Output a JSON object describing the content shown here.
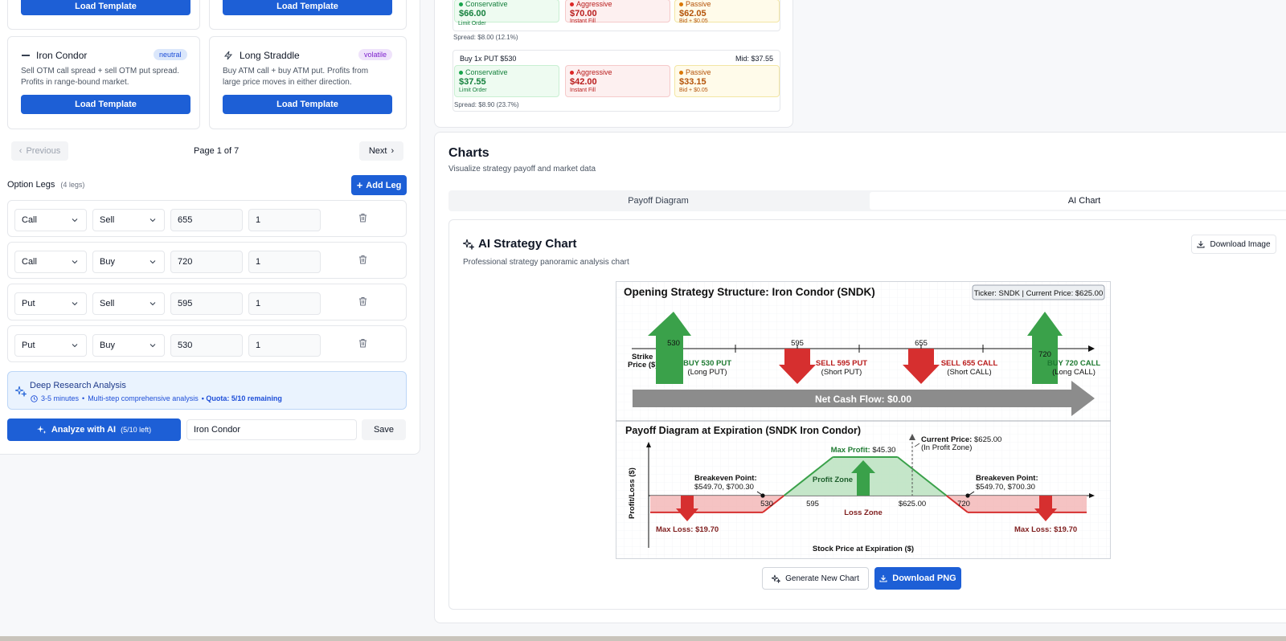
{
  "templates": {
    "top_buttons": [
      "Load Template",
      "Load Template"
    ],
    "cards": [
      {
        "name": "Iron Condor",
        "tag": "neutral",
        "description_1": "Sell OTM call spread + sell OTM put spread.",
        "description_2": "Profits in range-bound market.",
        "button": "Load Template"
      },
      {
        "name": "Long Straddle",
        "tag": "volatile",
        "description_1": "Buy ATM call + buy ATM put. Profits from",
        "description_2": "large price moves in either direction.",
        "button": "Load Template"
      }
    ],
    "pagination": {
      "previous": "Previous",
      "page": "Page 1 of 7",
      "next": "Next"
    }
  },
  "legs_section": {
    "title": "Option Legs",
    "count": "(4 legs)",
    "add_button": "Add Leg"
  },
  "legs": [
    {
      "type": "Call",
      "action": "Sell",
      "strike": "655",
      "qty": "1"
    },
    {
      "type": "Call",
      "action": "Buy",
      "strike": "720",
      "qty": "1"
    },
    {
      "type": "Put",
      "action": "Sell",
      "strike": "595",
      "qty": "1"
    },
    {
      "type": "Put",
      "action": "Buy",
      "strike": "530",
      "qty": "1"
    }
  ],
  "research": {
    "title": "Deep Research Analysis",
    "duration": "3-5 minutes",
    "detail": "Multi-step comprehensive analysis",
    "quota": "• Quota: 5/10 remaining"
  },
  "analyze": {
    "button": "Analyze with AI",
    "left": "(5/10 left)",
    "name_value": "Iron Condor",
    "save": "Save"
  },
  "quotes": {
    "top": {
      "cons_label": "Conservative",
      "cons_price": "$66.00",
      "cons_sub": "Limit Order",
      "aggr_label": "Aggressive",
      "aggr_price": "$70.00",
      "aggr_sub": "Instant Fill",
      "pass_label": "Passive",
      "pass_price": "$62.05",
      "pass_sub": "Bid + $0.05",
      "spread": "Spread: $8.00 (12.1%)"
    },
    "put": {
      "title": "Buy 1x PUT $530",
      "mid": "Mid: $37.55",
      "cons_label": "Conservative",
      "cons_price": "$37.55",
      "cons_sub": "Limit Order",
      "aggr_label": "Aggressive",
      "aggr_price": "$42.00",
      "aggr_sub": "Instant Fill",
      "pass_label": "Passive",
      "pass_price": "$33.15",
      "pass_sub": "Bid + $0.05",
      "spread": "Spread: $8.90 (23.7%)"
    }
  },
  "charts": {
    "title": "Charts",
    "subtitle": "Visualize strategy payoff and market data",
    "tabs": [
      "Payoff Diagram",
      "AI Chart"
    ],
    "ai_title": "AI Strategy Chart",
    "ai_subtitle": "Professional strategy panoramic analysis chart",
    "download_image": "Download Image",
    "generate": "Generate New Chart",
    "download_png": "Download PNG"
  },
  "figure": {
    "structure_title": "Opening Strategy Structure: Iron Condor (SNDK)",
    "ticker": "Ticker: SNDK | Current Price: $625.00",
    "strike_label_1": "Strike",
    "strike_label_2": "Price ($)",
    "strikes": [
      "530",
      "595",
      "655",
      "720"
    ],
    "leg_labels": [
      {
        "main": "BUY 530 PUT",
        "sub": "(Long PUT)"
      },
      {
        "main": "SELL 595 PUT",
        "sub": "(Short PUT)"
      },
      {
        "main": "SELL 655 CALL",
        "sub": "(Short CALL)"
      },
      {
        "main": "BUY 720 CALL",
        "sub": "(Long CALL)"
      }
    ],
    "net_cash": "Net Cash Flow: $0.00",
    "payoff_title": "Payoff Diagram at Expiration (SNDK Iron Condor)",
    "ylabel": "Profit/Loss ($)",
    "xlabel": "Stock Price at Expiration ($)",
    "max_profit_label": "Max Profit:",
    "max_profit_value": "$45.30",
    "current_label": "Current Price:",
    "current_value": "$625.00",
    "current_sub": "(In Profit Zone)",
    "breakeven_label": "Breakeven Point:",
    "breakeven_values": "$549.70, $700.30",
    "profit_zone": "Profit Zone",
    "loss_zone": "Loss Zone",
    "max_loss_left": "Max Loss: $19.70",
    "max_loss_right": "Max Loss: $19.70",
    "x_ticks": [
      "530",
      "595",
      "$625.00",
      "720"
    ]
  },
  "chart_data": {
    "type": "line",
    "title": "Payoff Diagram at Expiration (SNDK Iron Condor)",
    "xlabel": "Stock Price at Expiration ($)",
    "ylabel": "Profit/Loss ($)",
    "x": [
      500,
      530,
      549.7,
      595,
      655,
      700.3,
      720,
      750
    ],
    "y": [
      -19.7,
      -19.7,
      0,
      45.3,
      45.3,
      0,
      -19.7,
      -19.7
    ],
    "colors": {
      "profit": "#3aa14a",
      "loss": "#d62f2f"
    }
  },
  "colors": {
    "accent": "#1d5fd6",
    "green": "#3aa14a",
    "red": "#d62f2f"
  }
}
